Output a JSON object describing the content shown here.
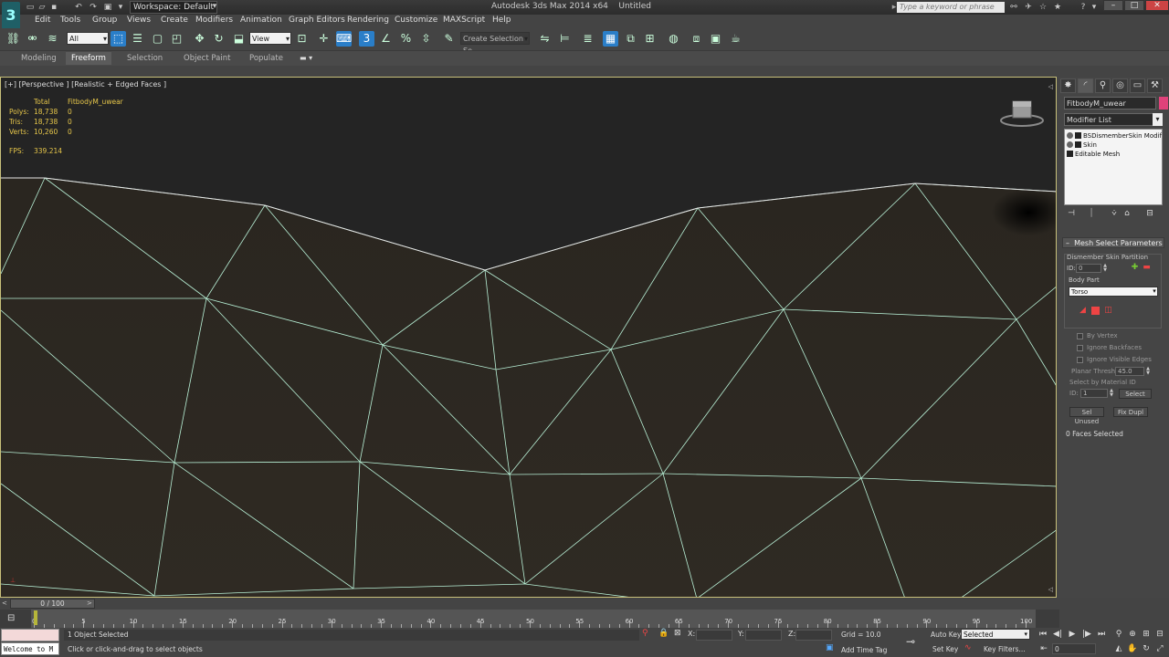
{
  "window": {
    "app_icon": "3ds-max-logo",
    "workspace": "Workspace: Default",
    "title": "Autodesk 3ds Max 2014 x64",
    "document": "Untitled",
    "search_placeholder": "Type a keyword or phrase"
  },
  "menu": [
    "Edit",
    "Tools",
    "Group",
    "Views",
    "Create",
    "Modifiers",
    "Animation",
    "Graph Editors",
    "Rendering",
    "Customize",
    "MAXScript",
    "Help"
  ],
  "toolbar": {
    "selection_filter": "All",
    "ref_coord": "View",
    "named_selection": "Create Selection Se",
    "snap_value": "3"
  },
  "ribbon": {
    "tabs": [
      "Modeling",
      "Freeform",
      "Selection",
      "Object Paint",
      "Populate"
    ],
    "active": "Freeform"
  },
  "viewport": {
    "label": "[+] [Perspective ] [Realistic + Edged Faces ]",
    "stats": {
      "header_total": "Total",
      "header_object": "FitbodyM_uwear",
      "rows": [
        {
          "label": "Polys:",
          "total": "18,738",
          "object": "0"
        },
        {
          "label": "Tris:",
          "total": "18,738",
          "object": "0"
        },
        {
          "label": "Verts:",
          "total": "10,260",
          "object": "0"
        }
      ],
      "fps_label": "FPS:",
      "fps_value": "339.214"
    }
  },
  "command_panel": {
    "object_name": "FitbodyM_uwear",
    "object_color": "#e0427a",
    "modifier_list": "Modifier List",
    "stack": [
      "BSDismemberSkin Modifier",
      "Skin",
      "Editable Mesh"
    ],
    "rollout_title": "Mesh Select Parameters",
    "group_title": "Dismember Skin Partition",
    "id_label": "ID:",
    "id_value": "0",
    "body_part_label": "Body Part",
    "body_part": "Torso",
    "by_vertex": "By Vertex",
    "ignore_backfaces": "Ignore Backfaces",
    "ignore_visible_edges": "Ignore Visible Edges",
    "planar_thresh_label": "Planar Thresh:",
    "planar_thresh_value": "45.0",
    "select_by_material_id": "Select by Material ID",
    "mat_id_label": "ID:",
    "mat_id_value": "1",
    "select_button": "Select",
    "sel_unused": "Sel Unused",
    "fix_dupl": "Fix Dupl",
    "faces_selected": "0 Faces Selected"
  },
  "timeline": {
    "range": "0 / 100",
    "ticks": [
      "0",
      "5",
      "10",
      "15",
      "20",
      "25",
      "30",
      "35",
      "40",
      "45",
      "50",
      "55",
      "60",
      "65",
      "70",
      "75",
      "80",
      "85",
      "90",
      "95",
      "100"
    ]
  },
  "status": {
    "welcome": "Welcome to M",
    "objects_selected": "1 Object Selected",
    "prompt": "Click or click-and-drag to select objects",
    "x_label": "X:",
    "y_label": "Y:",
    "z_label": "Z:",
    "grid": "Grid = 10.0",
    "add_time_tag": "Add Time Tag",
    "auto_key": "Auto Key",
    "set_key": "Set Key",
    "key_mode": "Selected",
    "key_filters": "Key Filters...",
    "frame": "0"
  },
  "colors": {
    "viewport_border": "#c8c07a",
    "wire": "#b8f0d6",
    "stats_text": "#e6c64a",
    "active_blue": "#2a7ec8"
  }
}
